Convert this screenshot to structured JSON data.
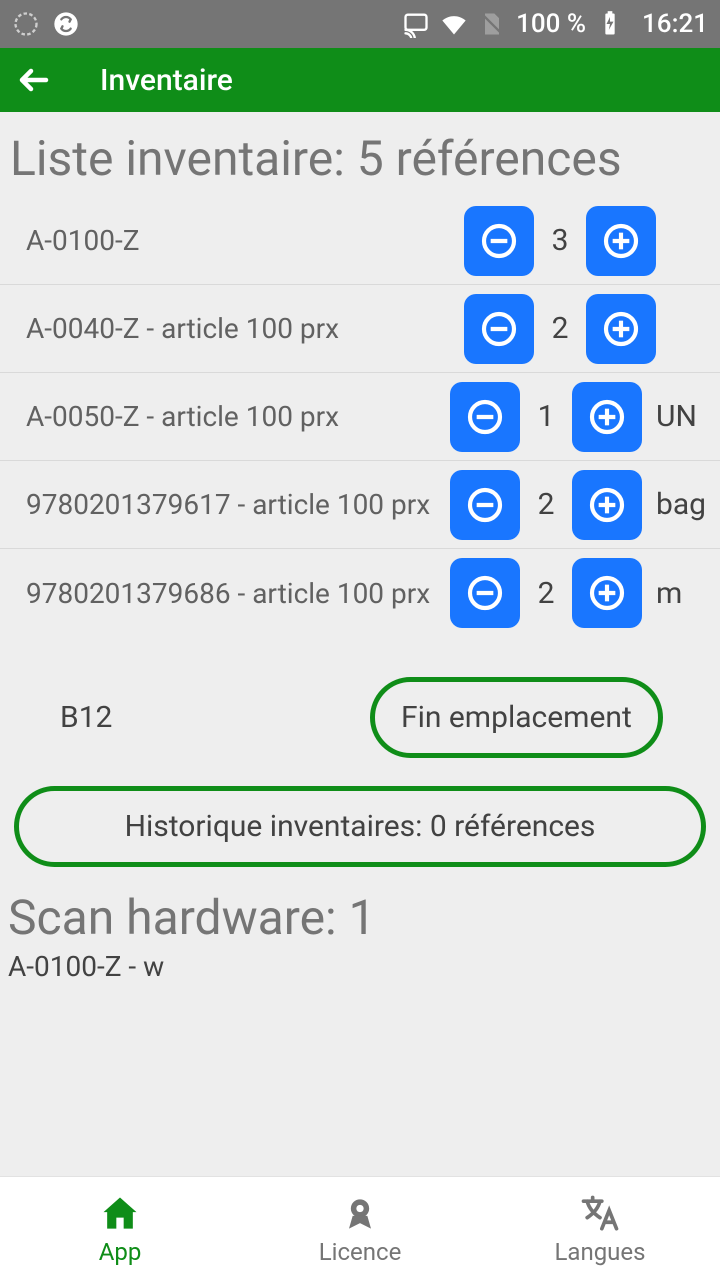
{
  "statusbar": {
    "battery_pct": "100 %",
    "time": "16:21"
  },
  "appbar": {
    "title": "Inventaire"
  },
  "main": {
    "heading": "Liste inventaire: 5 références",
    "items": [
      {
        "label": "A-0100-Z",
        "qty": "3",
        "unit": ""
      },
      {
        "label": "A-0040-Z - article 100 prx",
        "qty": "2",
        "unit": ""
      },
      {
        "label": "A-0050-Z - article 100 prx",
        "qty": "1",
        "unit": "UN"
      },
      {
        "label": "9780201379617 - article 100 prx",
        "qty": "2",
        "unit": "bag"
      },
      {
        "label": "9780201379686 - article 100 prx",
        "qty": "2",
        "unit": "m"
      }
    ],
    "location": "B12",
    "end_location_label": "Fin emplacement",
    "history_label": "Historique inventaires: 0 références",
    "scan_heading": "Scan hardware: 1",
    "scan_line": "A-0100-Z - w"
  },
  "nav": {
    "app": "App",
    "licence": "Licence",
    "langues": "Langues"
  }
}
